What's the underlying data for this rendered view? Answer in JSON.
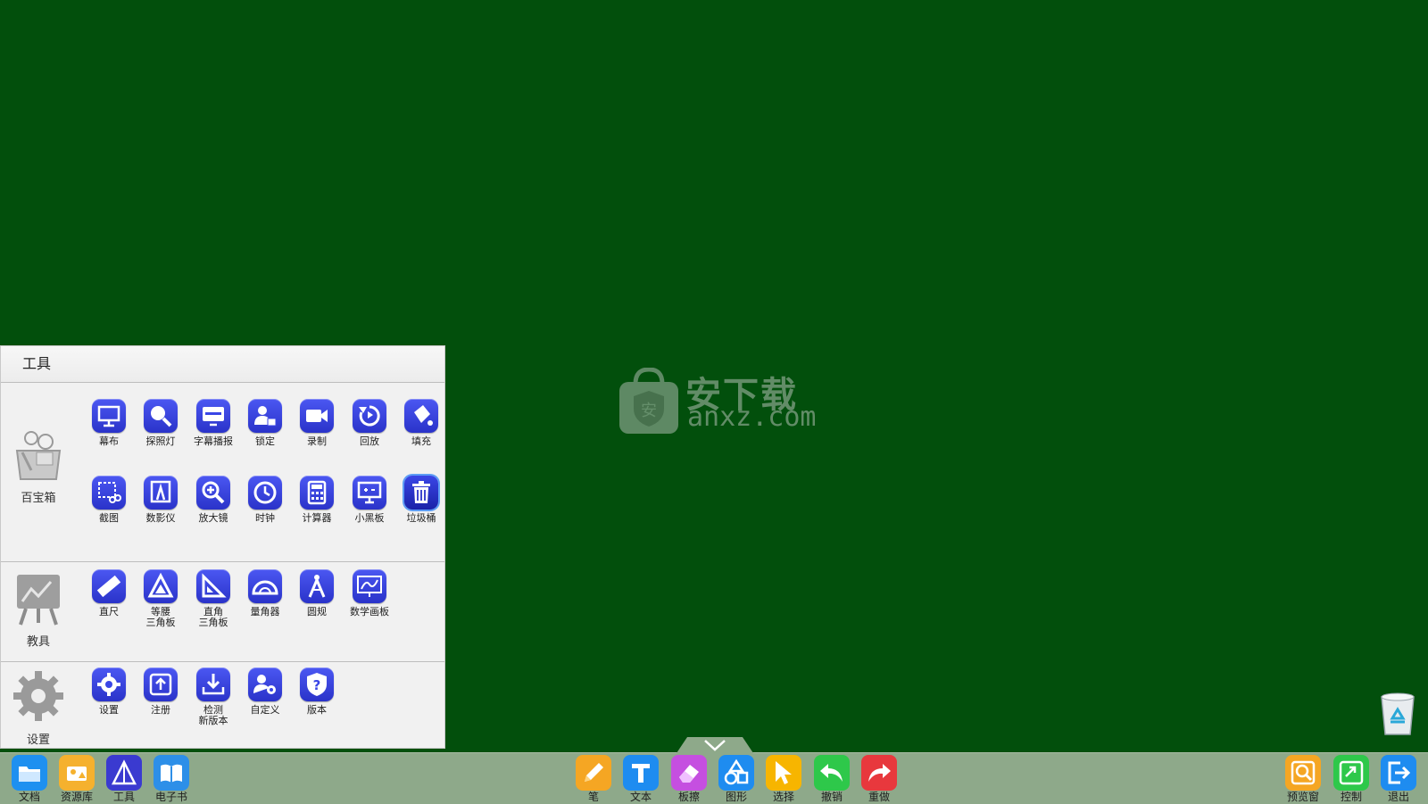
{
  "watermark": {
    "cn": "安下载",
    "en": "anxz.com",
    "bag_char": "安"
  },
  "panel": {
    "title": "工具",
    "sections": [
      {
        "name": "百宝箱",
        "tools": [
          {
            "label": "幕布",
            "icon": "screen-icon"
          },
          {
            "label": "探照灯",
            "icon": "search-light-icon"
          },
          {
            "label": "字幕播报",
            "icon": "subtitle-broadcast-icon"
          },
          {
            "label": "锁定",
            "icon": "lock-user-icon"
          },
          {
            "label": "录制",
            "icon": "camera-icon"
          },
          {
            "label": "回放",
            "icon": "replay-icon"
          },
          {
            "label": "填充",
            "icon": "fill-bucket-icon"
          },
          {
            "label": "截图",
            "icon": "screenshot-icon"
          },
          {
            "label": "数影仪",
            "icon": "document-camera-icon"
          },
          {
            "label": "放大镜",
            "icon": "magnifier-icon"
          },
          {
            "label": "时钟",
            "icon": "clock-icon"
          },
          {
            "label": "计算器",
            "icon": "calculator-icon"
          },
          {
            "label": "小黑板",
            "icon": "small-blackboard-icon"
          },
          {
            "label": "垃圾桶",
            "icon": "trash-icon"
          }
        ]
      },
      {
        "name": "教具",
        "tools": [
          {
            "label": "直尺",
            "icon": "ruler-icon"
          },
          {
            "label": "等腰\n三角板",
            "icon": "isosceles-triangle-icon"
          },
          {
            "label": "直角\n三角板",
            "icon": "right-triangle-icon"
          },
          {
            "label": "量角器",
            "icon": "protractor-icon"
          },
          {
            "label": "圆规",
            "icon": "compass-icon"
          },
          {
            "label": "数学画板",
            "icon": "math-board-icon"
          }
        ]
      },
      {
        "name": "设置",
        "tools": [
          {
            "label": "设置",
            "icon": "gear-icon"
          },
          {
            "label": "注册",
            "icon": "register-icon"
          },
          {
            "label": "检测\n新版本",
            "icon": "download-update-icon"
          },
          {
            "label": "自定义",
            "icon": "custom-user-icon"
          },
          {
            "label": "版本",
            "icon": "version-shield-icon"
          }
        ]
      }
    ]
  },
  "toolbar": {
    "left": [
      {
        "label": "文档",
        "icon": "folder-icon",
        "color": "#1e90f0"
      },
      {
        "label": "资源库",
        "icon": "resource-icon",
        "color": "#f5b12e"
      },
      {
        "label": "工具",
        "icon": "tools-icon",
        "color": "#3a3ad0"
      },
      {
        "label": "电子书",
        "icon": "ebook-icon",
        "color": "#2d8fe8"
      }
    ],
    "center": [
      {
        "label": "笔",
        "icon": "pen-icon",
        "color": "#f5a623"
      },
      {
        "label": "文本",
        "icon": "text-icon",
        "color": "#1e8cf0"
      },
      {
        "label": "板擦",
        "icon": "eraser-icon",
        "color": "#c54fe0"
      },
      {
        "label": "图形",
        "icon": "shapes-icon",
        "color": "#1e8cf0"
      },
      {
        "label": "选择",
        "icon": "select-cursor-icon",
        "color": "#f7b500"
      },
      {
        "label": "撤销",
        "icon": "undo-icon",
        "color": "#2ec84a"
      },
      {
        "label": "重做",
        "icon": "redo-icon",
        "color": "#e8383d"
      }
    ],
    "right": [
      {
        "label": "预览窗",
        "icon": "preview-icon",
        "color": "#f5a623"
      },
      {
        "label": "控制",
        "icon": "control-icon",
        "color": "#2ec84a"
      },
      {
        "label": "退出",
        "icon": "exit-icon",
        "color": "#1e8cf0"
      }
    ]
  }
}
